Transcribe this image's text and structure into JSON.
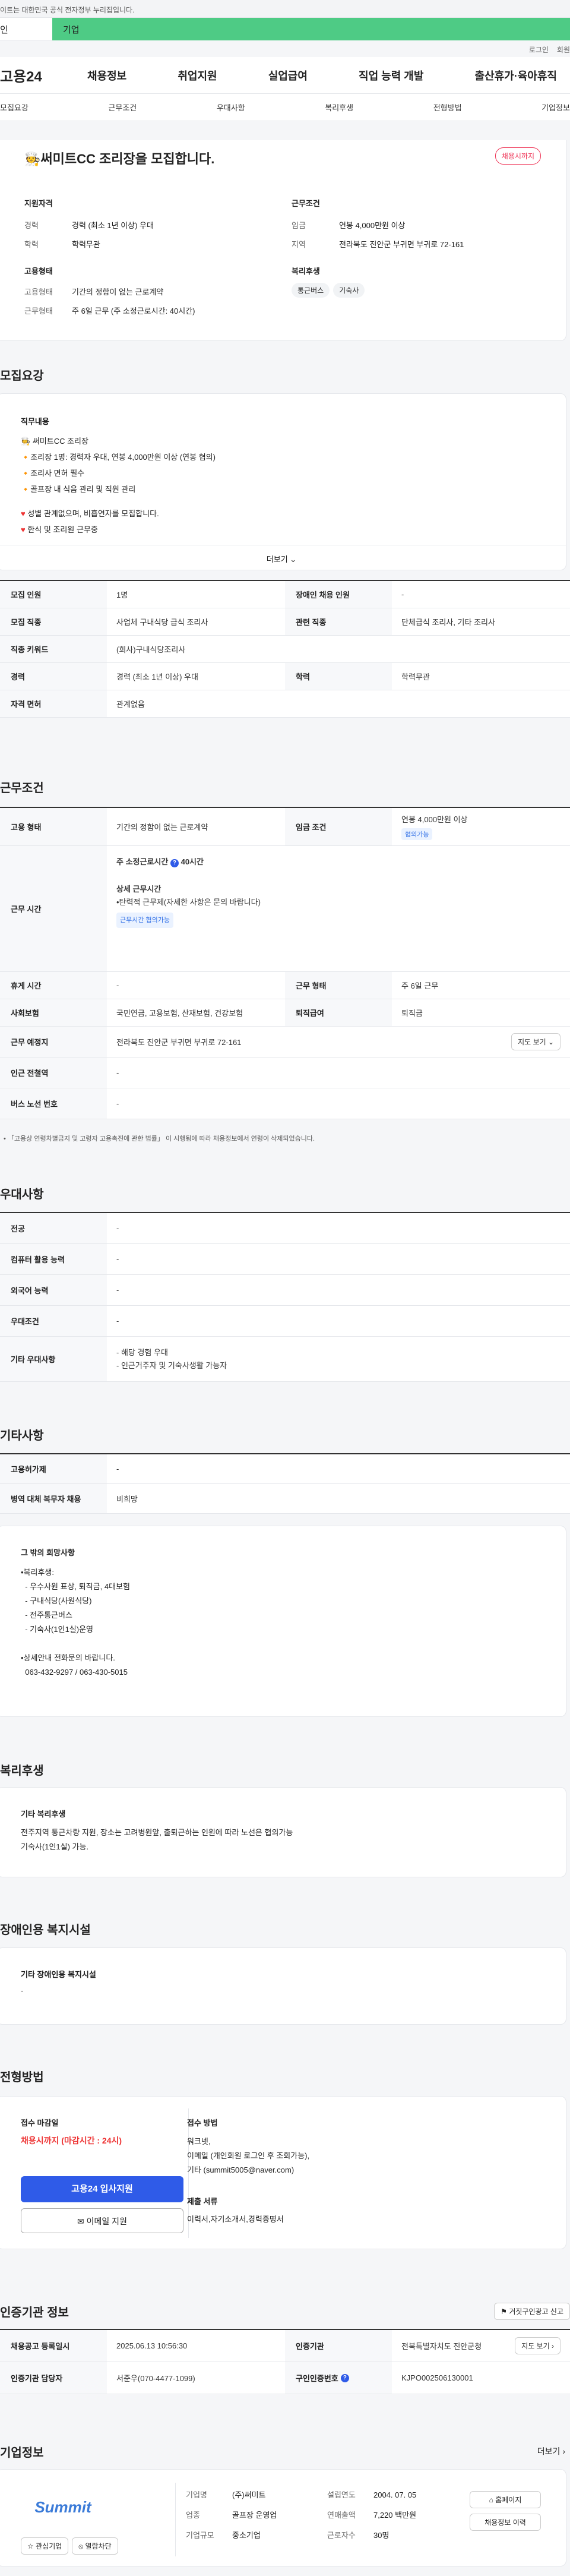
{
  "top": {
    "notice": "이트는 대한민국 공식 전자정부 누리집입니다.",
    "tab_a": "인",
    "tab_b": "기업"
  },
  "util": {
    "login": "로그인",
    "join": "회원"
  },
  "gnb": {
    "logo": "고용24",
    "menu": [
      "채용정보",
      "취업지원",
      "실업급여",
      "직업 능력 개발",
      "출산휴가·육아휴직"
    ]
  },
  "subnav": [
    "모집요강",
    "근무조건",
    "우대사항",
    "복리후생",
    "전형방법",
    "기업정보"
  ],
  "summary": {
    "title": "써미트CC 조리장을 모집합니다.",
    "badge": "채용시까지",
    "qual_title": "지원자격",
    "qual": [
      {
        "k": "경력",
        "v": "경력 (최소 1년 이상) 우대"
      },
      {
        "k": "학력",
        "v": "학력무관"
      }
    ],
    "cond_title": "근무조건",
    "cond": [
      {
        "k": "임금",
        "v": "연봉 4,000만원 이상"
      },
      {
        "k": "지역",
        "v": "전라북도 진안군 부귀면 부귀로 72-161"
      }
    ],
    "emp_title": "고용형태",
    "emp": [
      {
        "k": "고용형태",
        "v": "기간의 정함이 없는 근로계약"
      },
      {
        "k": "근무형태",
        "v": "주 6일 근무 (주 소정근로시간: 40시간)"
      }
    ],
    "welfare_title": "복리후생",
    "welfare": [
      "통근버스",
      "기숙사"
    ]
  },
  "recruit": {
    "heading": "모집요강",
    "duty_title": "직무내용",
    "duty_lines": [
      "써미트CC 조리장",
      "조리장 1명: 경력자 우대, 연봉 4,000만원 이상 (연봉 협의)",
      "조리사 면허 필수",
      "골프장 내 식음 관리 및 직원 관리",
      "",
      "성별 관계없으며, 비흡연자를 모집합니다.",
      "한식 및 조리원 근무중"
    ],
    "more": "더보기",
    "rows": [
      [
        "모집 인원",
        "1명",
        "장애인 채용 인원",
        "-"
      ],
      [
        "모집 직종",
        "사업체 구내식당 급식 조리사",
        "관련 직종",
        "단체급식 조리사, 기타 조리사"
      ],
      [
        "직종 키워드",
        "(희사)구내식당조리사",
        "",
        ""
      ],
      [
        "경력",
        "경력 (최소 1년 이상) 우대",
        "학력",
        "학력무관"
      ],
      [
        "자격 면허",
        "관계없음",
        "",
        ""
      ]
    ]
  },
  "work": {
    "heading": "근무조건",
    "rows": [
      [
        "고용 형태",
        "기간의 정함이 없는 근로계약",
        "임금 조건",
        "연봉 4,000만원 이상"
      ]
    ],
    "wage_chip": "협의가능",
    "time_label": "근무 시간",
    "time_main": "주 소정근로시간",
    "time_hours": "40시간",
    "time_detail_title": "상세 근무시간",
    "time_detail": "•탄력적 근무제(자세한 사항은 문의 바랍니다)",
    "time_chip": "근무시간 협의가능",
    "rows2": [
      [
        "휴게 시간",
        "-",
        "근무 형태",
        "주 6일 근무"
      ],
      [
        "사회보험",
        "국민연금, 고용보험, 산재보험, 건강보험",
        "퇴직급여",
        "퇴직금"
      ],
      [
        "근무 예정지",
        "전라북도 진안군 부귀면 부귀로 72-161",
        "",
        ""
      ],
      [
        "인근 전철역",
        "-",
        "",
        ""
      ],
      [
        "버스 노선 번호",
        "-",
        "",
        ""
      ]
    ],
    "map_btn": "지도 보기",
    "footnote": "「고용상 연령차별금지 및 고령자 고용촉진에 관한 법률」 이 시행됨에 따라 채용정보에서 연령이 삭제되었습니다."
  },
  "pref": {
    "heading": "우대사항",
    "rows": [
      [
        "전공",
        "-"
      ],
      [
        "컴퓨터 활용 능력",
        "-"
      ],
      [
        "외국어 능력",
        "-"
      ],
      [
        "우대조건",
        "-"
      ],
      [
        "기타 우대사항",
        "- 해당 경험 우대\n- 인근거주자 및 기숙사생활 가능자"
      ]
    ]
  },
  "etc": {
    "heading": "기타사항",
    "rows": [
      [
        "고용허가제",
        "-"
      ],
      [
        "병역 대체 복무자 채용",
        "비희망"
      ]
    ],
    "wish_title": "그 밖의 희망사항",
    "wish_lines": [
      "•복리후생:",
      "  - 우수사원 표상, 퇴직금, 4대보험",
      "  - 구내식당(사원식당)",
      "  - 전주통근버스",
      "  - 기숙사(1인1실)운영",
      "",
      "•상세안내 전화문의 바랍니다.",
      "  063-432-9297 / 063-430-5015"
    ]
  },
  "welfare": {
    "heading": "복리후생",
    "title": "기타 복리후생",
    "text": "전주지역 통근차량 지원, 장소는 고려병원앞, 출퇴근하는 인원에 따라 노선은 협의가능\n기숙사(1인1실) 가능."
  },
  "disab": {
    "heading": "장애인용 복지시설",
    "title": "기타 장애인용 복지시설",
    "text": "-"
  },
  "process": {
    "heading": "전형방법",
    "deadline_title": "접수 마감일",
    "deadline": "채용시까지 (마감시간 : 24시)",
    "apply_btn": "고용24 입사지원",
    "email_btn": "이메일 지원",
    "method_title": "접수 방법",
    "method": "워크넷,\n이메일 (개인회원 로그인 후 조회가능),\n기타 (summit5005@naver.com)",
    "docs_title": "제출 서류",
    "docs": "이력서,자기소개서,경력증명서"
  },
  "cert": {
    "heading": "인증기관 정보",
    "report_btn": "거짓구인광고 신고",
    "rows": [
      [
        "채용공고 등록일시",
        "2025.06.13 10:56:30",
        "인증기관",
        "전북특별자치도 진안군청"
      ],
      [
        "인증기관 담당자",
        "서준우(070-4477-1099)",
        "구인인증번호",
        "KJPO002506130001"
      ]
    ],
    "map_btn": "지도 보기"
  },
  "company": {
    "heading": "기업정보",
    "more": "더보기",
    "logo": "Summit",
    "fav": "관심기업",
    "block": "열람차단",
    "info": [
      [
        "기업명",
        "(주)써미트",
        "설립연도",
        "2004. 07. 05"
      ],
      [
        "업종",
        "골프장 운영업",
        "연매출액",
        "7,220 백만원"
      ],
      [
        "기업규모",
        "중소기업",
        "근로자수",
        "30명"
      ]
    ],
    "home_btn": "홈페이지",
    "hist_btn": "채용정보 이력"
  }
}
